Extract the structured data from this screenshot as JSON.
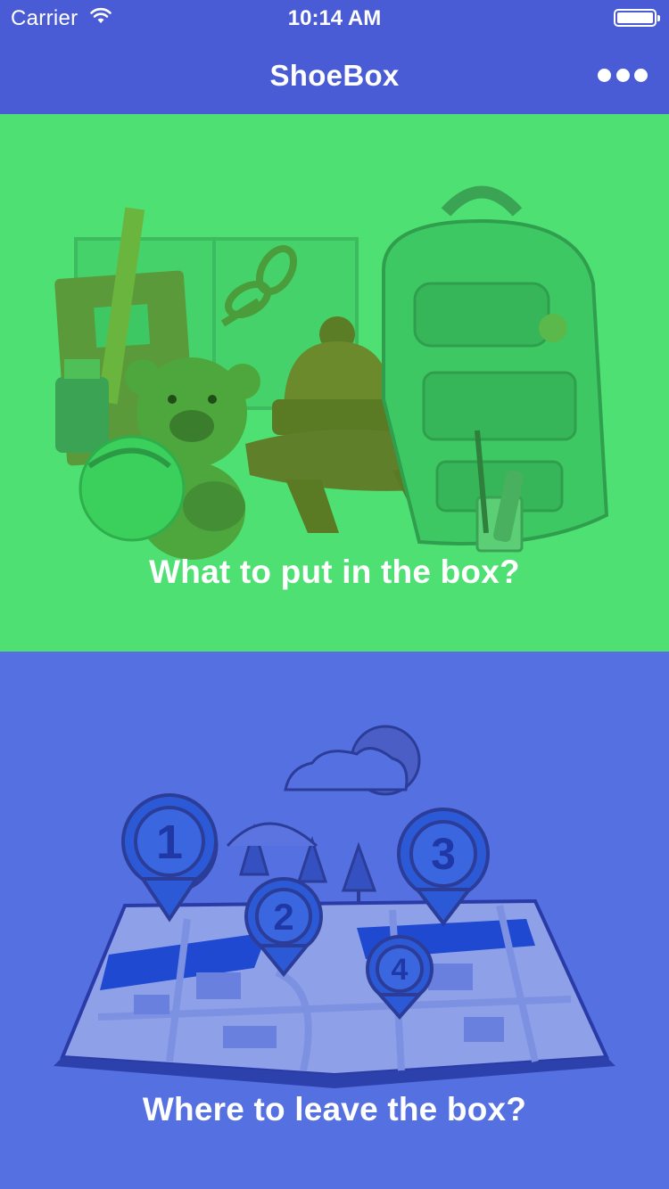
{
  "status_bar": {
    "carrier": "Carrier",
    "time": "10:14 AM",
    "wifi_icon": "wifi-icon",
    "battery_icon": "battery-icon"
  },
  "nav": {
    "title": "ShoeBox",
    "more_icon": "more-horizontal-icon"
  },
  "panels": [
    {
      "caption": "What to put in the box?",
      "illustration": "school-supplies-teddy-bear-hat-scarf-backpack-illustration",
      "background": "#4fe074"
    },
    {
      "caption": "Where to leave the box?",
      "illustration": "map-with-numbered-location-pins-illustration",
      "background": "#5570e0",
      "pin_labels": [
        "1",
        "2",
        "3",
        "4"
      ]
    }
  ],
  "colors": {
    "nav_background": "#4a5bd6",
    "text": "#ffffff"
  }
}
